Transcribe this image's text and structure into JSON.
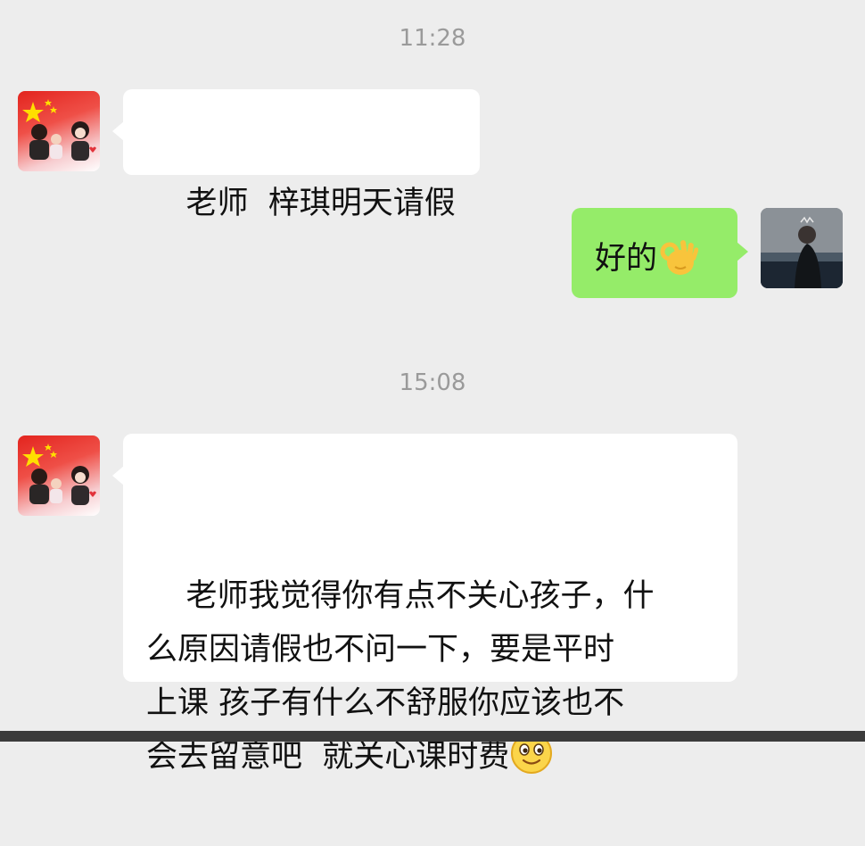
{
  "chat": {
    "messages_group_1": {
      "timestamp": "11:28"
    },
    "messages_group_2": {
      "timestamp": "15:08"
    },
    "msg1": {
      "sender": "contact",
      "text": "老师  梓琪明天请假"
    },
    "msg2": {
      "sender": "self",
      "text": "好的",
      "emoji": "ok-hand-emoji"
    },
    "msg3": {
      "sender": "contact",
      "text": "老师我觉得你有点不关心孩子，什\n么原因请假也不问一下，要是平时\n上课 孩子有什么不舒服你应该也不\n会去留意吧  就关心课时费",
      "emoji": "smiley-emoji"
    }
  },
  "colors": {
    "background": "#ededed",
    "incoming_bubble": "#ffffff",
    "outgoing_bubble": "#95ec69",
    "timestamp": "#9a9a9a"
  }
}
